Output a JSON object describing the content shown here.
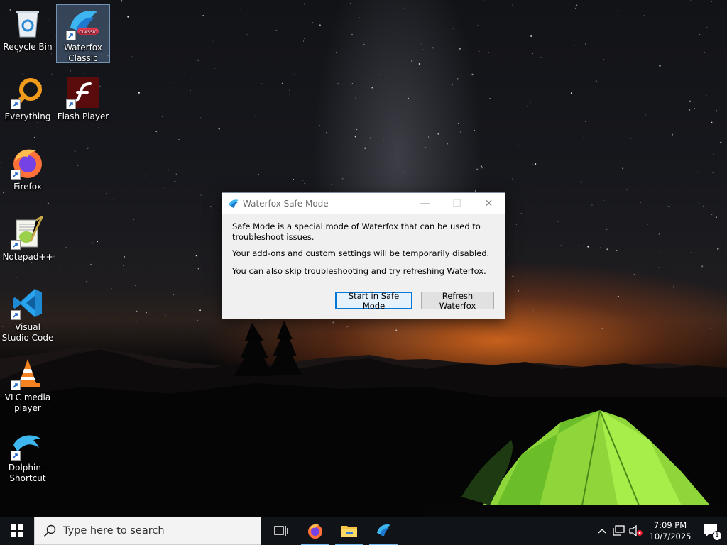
{
  "desktop_icons": [
    {
      "label": "Recycle Bin",
      "icon": "recycle-bin-icon"
    },
    {
      "label": "Waterfox Classic",
      "icon": "waterfox-classic-icon",
      "selected": true
    },
    {
      "label": "Everything",
      "icon": "everything-search-icon"
    },
    {
      "label": "Flash Player",
      "icon": "flash-player-icon"
    },
    {
      "label": "Firefox",
      "icon": "firefox-icon"
    },
    {
      "label": "Notepad++",
      "icon": "notepad-plus-plus-icon"
    },
    {
      "label": "Visual Studio Code",
      "icon": "vscode-icon"
    },
    {
      "label": "VLC media player",
      "icon": "vlc-icon"
    },
    {
      "label": "Dolphin - Shortcut",
      "icon": "dolphin-icon"
    }
  ],
  "dialog": {
    "title": "Waterfox Safe Mode",
    "paragraphs": [
      "Safe Mode is a special mode of Waterfox that can be used to troubleshoot issues.",
      "Your add-ons and custom settings will be temporarily disabled.",
      "You can also skip troubleshooting and try refreshing Waterfox."
    ],
    "buttons": {
      "safe_mode": "Start in Safe Mode",
      "refresh": "Refresh Waterfox"
    },
    "window_controls": {
      "minimize": "—",
      "maximize": "☐",
      "close": "✕"
    }
  },
  "taskbar": {
    "search_placeholder": "Type here to search",
    "apps": [
      "task-view",
      "firefox",
      "file-explorer",
      "waterfox"
    ],
    "clock": {
      "time": "7:09 PM",
      "date": "10/7/2025"
    },
    "notification_count": "1"
  },
  "colors": {
    "accent": "#0078d7",
    "taskbar": "#101318",
    "dialog_bg": "#f0f0f0"
  }
}
